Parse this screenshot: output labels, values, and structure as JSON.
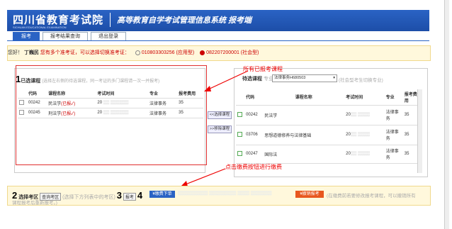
{
  "header": {
    "title": "四川省教育考试院",
    "subtitle": "SICHUAN EDUCATIONAL EXAMINATION",
    "system": "高等教育自学考试管理信息系统 报考端"
  },
  "tabs": [
    {
      "label": "报考"
    },
    {
      "label": "报考结果查询"
    },
    {
      "label": "退出登录"
    }
  ],
  "notice": {
    "hello": "您好",
    "name": "丁巍民",
    "msg": "您有多个准考证，可以选择切换准考证：",
    "opt1": "010803303256 (应用型)",
    "opt2": "082207200001 (社会型)"
  },
  "left": {
    "step": "1",
    "title": "已选课程",
    "hint": "(选择左右侧的待选课程，同一考证的多门课程请一次一并报考)",
    "headers": [
      "代码",
      "课程名称",
      "考试时间",
      "专业",
      "报考费用"
    ],
    "rows": [
      {
        "code": "00242",
        "name": "民法学",
        "tag": "(已报✓)",
        "time": "20",
        "major": "法律事务",
        "fee": "35"
      },
      {
        "code": "00245",
        "name": "刑法学",
        "tag": "(已报✓)",
        "time": "20",
        "major": "法律事务",
        "fee": "35"
      }
    ]
  },
  "middle": {
    "select_btn": "<<选择课程",
    "remove_btn": ">>移除课程"
  },
  "right": {
    "title": "待选课程",
    "major_label": "专业:",
    "major_value": "法律事务H680503",
    "hint": "(社会型考生切换专业)",
    "headers": [
      "代码",
      "课程名称",
      "考试时间",
      "专业",
      "报考费用"
    ],
    "rows": [
      {
        "code": "00242",
        "name": "民法学",
        "time": "20",
        "major": "法律事务",
        "fee": "35"
      },
      {
        "code": "03706",
        "name": "思想道德修养与法律基础",
        "time": "20",
        "major": "法律事务",
        "fee": "35"
      },
      {
        "code": "00247",
        "name": "国际法",
        "time": "20",
        "major": "法律事务",
        "fee": "35"
      }
    ]
  },
  "annotations": {
    "top": "所有已报考课程",
    "bottom": "点击缴费按钮进行缴费"
  },
  "bottom": {
    "step2": "2",
    "step2_label": "选择考区",
    "query_btn": "查询考区",
    "step2_hint": "(选择下方列表中的考区)",
    "step3": "3",
    "step3_btn": "报考",
    "step4": "4",
    "pay_btn": "¥缴费下单",
    "cancel_btn": "¥撤销报考",
    "cancel_hint": "(在缴费前若要修改报考课程，可以撤销所有",
    "cancel_hint2": "课程报考后重新报考。)"
  },
  "colors": {
    "brand": "#2a63c4",
    "accent": "#e8571f",
    "annotation": "#e00000"
  }
}
